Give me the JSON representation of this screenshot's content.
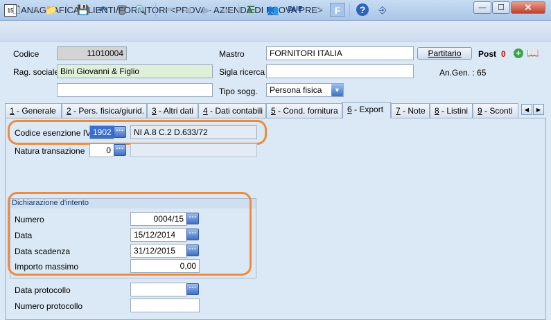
{
  "window": {
    "app_badge": "15",
    "title": "ANAGRAFICA CLIENTI/FORNITORI <PROVA - AZIENDA DI PROVA PRE>",
    "min_glyph": "—",
    "max_glyph": "☐",
    "close_glyph": "✕"
  },
  "toolbar": {
    "new": "🗋",
    "copy": "⧉",
    "open": "📁",
    "save": "💾",
    "undo": "↶",
    "delete": "🗑",
    "find": "🔍",
    "first": "⏮",
    "prev": "◀",
    "next": "▶",
    "last": "⏭",
    "list": "☰",
    "users": "👥",
    "due": "DUE",
    "refresh": "⟳",
    "form": "F",
    "help": "?",
    "exit": "⎆"
  },
  "header": {
    "codice_label": "Codice",
    "codice_value": "11010004",
    "rag_sociale_label": "Rag. sociale",
    "rag_sociale_value": "Bini Giovanni & Figlio",
    "rag_sociale2_value": "",
    "mastro_label": "Mastro",
    "mastro_value": "FORNITORI ITALIA",
    "sigla_label": "Sigla ricerca",
    "sigla_value": "",
    "tipo_label": "Tipo sogg.",
    "tipo_value": "Persona fisica",
    "partitario_label": "Partitario",
    "post_label": "Post",
    "post_count": "0",
    "angen_label": "An.Gen. : 65"
  },
  "tabs": [
    {
      "key": "1",
      "label": " - Generale"
    },
    {
      "key": "2",
      "label": " - Pers. fisica/giurid."
    },
    {
      "key": "3",
      "label": " - Altri dati"
    },
    {
      "key": "4",
      "label": " - Dati contabili"
    },
    {
      "key": "5",
      "label": " - Cond. fornitura"
    },
    {
      "key": "6",
      "label": " - Export"
    },
    {
      "key": "7",
      "label": " - Note"
    },
    {
      "key": "8",
      "label": " - Listini"
    },
    {
      "key": "9",
      "label": " - Sconti"
    }
  ],
  "export": {
    "codice_iva_label": "Codice esenzione IVA",
    "codice_iva_value": "1902",
    "codice_iva_desc": "NI A.8 C.2 D.633/72",
    "natura_label": "Natura transazione",
    "natura_value": "0",
    "dichiarazione_title": "Dichiarazione d'intento",
    "numero_label": "Numero",
    "numero_value": "0004/15",
    "data_label": "Data",
    "data_value": "15/12/2014",
    "scadenza_label": "Data scadenza",
    "scadenza_value": "31/12/2015",
    "importo_label": "Importo massimo",
    "importo_value": "0,00",
    "data_protocollo_label": "Data protocollo",
    "data_protocollo_value": "",
    "numero_protocollo_label": "Numero protocollo",
    "numero_protocollo_value": ""
  },
  "colors": {
    "highlight": "#f08a3c",
    "post_count": "#d40000",
    "panel": "#dbe8f5"
  }
}
